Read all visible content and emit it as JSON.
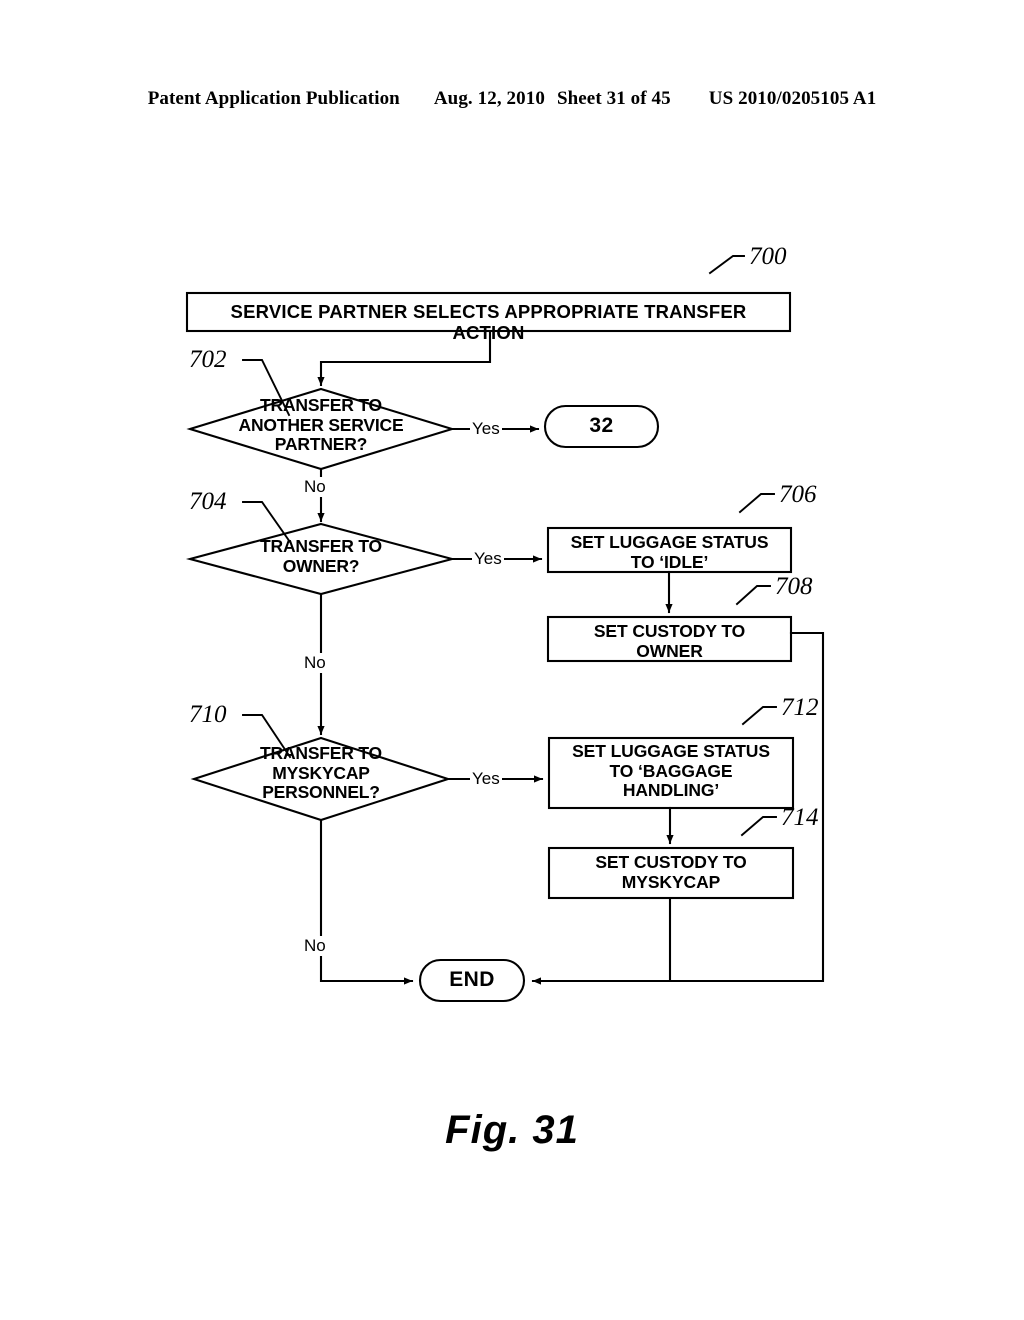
{
  "header": {
    "publication": "Patent Application Publication",
    "date": "Aug. 12, 2010",
    "sheet": "Sheet 31 of 45",
    "patent_number": "US 2010/0205105 A1"
  },
  "figure": {
    "caption": "Fig. 31"
  },
  "flowchart": {
    "nodes": {
      "start_banner": {
        "ref": "700",
        "label": "SERVICE PARTNER SELECTS APPROPRIATE TRANSFER ACTION",
        "shape": "process"
      },
      "decision_service_partner": {
        "ref": "702",
        "label": "TRANSFER TO\nANOTHER SERVICE\nPARTNER?",
        "shape": "decision"
      },
      "connector_32": {
        "label": "32",
        "shape": "terminal"
      },
      "decision_owner": {
        "ref": "704",
        "label": "TRANSFER TO\nOWNER?",
        "shape": "decision"
      },
      "set_status_idle": {
        "ref": "706",
        "label": "SET LUGGAGE STATUS\nTO ‘IDLE’",
        "shape": "process"
      },
      "set_custody_owner": {
        "ref": "708",
        "label": "SET CUSTODY TO\nOWNER",
        "shape": "process"
      },
      "decision_myskycap": {
        "ref": "710",
        "label": "TRANSFER TO\nMYSKYCAP\nPERSONNEL?",
        "shape": "decision"
      },
      "set_status_baggage_handling": {
        "ref": "712",
        "label": "SET LUGGAGE STATUS\nTO ‘BAGGAGE\nHANDLING’",
        "shape": "process"
      },
      "set_custody_myskycap": {
        "ref": "714",
        "label": "SET CUSTODY TO\nMYSKYCAP",
        "shape": "process"
      },
      "end_terminal": {
        "label": "END",
        "shape": "terminal"
      }
    },
    "edge_labels": {
      "yes_1": "Yes",
      "no_1": "No",
      "yes_2": "Yes",
      "no_2": "No",
      "yes_3": "Yes",
      "no_3": "No"
    },
    "reference_numerals": [
      "700",
      "702",
      "704",
      "706",
      "708",
      "710",
      "712",
      "714"
    ],
    "colors": {
      "ink": "#000000",
      "paper": "#ffffff"
    }
  }
}
